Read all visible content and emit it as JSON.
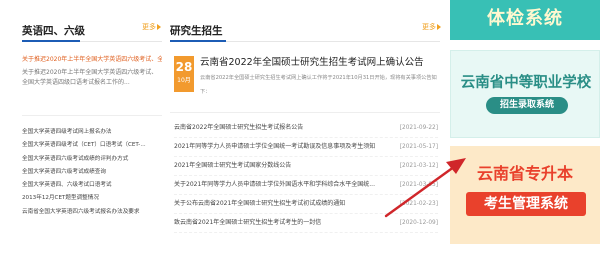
{
  "left_section": {
    "title": "英语四、六级",
    "more": "更多",
    "featured_title": "关于推迟2020年上半年全国大学英语四六级考试、全",
    "featured_desc": "关于推迟2020年上半年全国大学英语四六级考试、全国大学英语四级口语考试报名工作的...",
    "items": [
      "全国大学英语四级考试网上报名办法",
      "全国大学英语四级考试（CET）口语考试（CET-...",
      "全国大学英语四六级考试成绩的评判办方式",
      "全国大学英语四六级考试成绩查询",
      "全国大学英语四、六级考试口语考试",
      "2013年12月CET题型调整情况",
      "云南省全国大学英语四六级考试报名办法及要求"
    ]
  },
  "mid_section": {
    "title": "研究生招生",
    "more": "更多",
    "featured_day": "28",
    "featured_month": "10月",
    "featured_title": "云南省2022年全国硕士研究生招生考试网上确认公告",
    "featured_desc": "云南省2022年全国硕士研究生招生考试网上确认工作将于2021年10月31日开始，现将有关事项公告如下：",
    "items": [
      {
        "title": "云南省2022年全国硕士研究生招生考试报名公告",
        "date": "[2021-09-22]"
      },
      {
        "title": "2021年同等学力人员申请硕士学位全国统一考试勘误及信息事项及考生须知",
        "date": "[2021-05-17]"
      },
      {
        "title": "2021年全国硕士研究生考试国家分数线公告",
        "date": "[2021-03-12]"
      },
      {
        "title": "关于2021年同等学力人员申请硕士学位外国语水平和学科综合水平全国统...",
        "date": "[2021-03-05]"
      },
      {
        "title": "关于公布云南省2021年全国硕士研究生招生考试初试成绩的通知",
        "date": "[2021-02-23]"
      },
      {
        "title": "致云南省2021年全国硕士研究生招生考试考生的一封信",
        "date": "[2020-12-09]"
      }
    ]
  },
  "banners": {
    "b1_text": "体检系统",
    "b2_title": "云南省中等职业学校",
    "b2_button": "招生录取系统",
    "b3_title": "云南省专升本",
    "b3_button": "考生管理系统"
  },
  "colors": {
    "accent_blue": "#1c5cb5",
    "orange": "#f29a2e",
    "teal": "#2a8e86",
    "red": "#e9412c"
  }
}
